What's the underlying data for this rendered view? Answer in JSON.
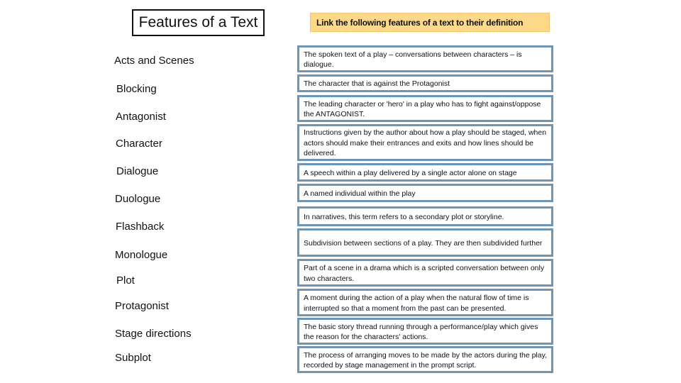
{
  "title": "Features of a Text",
  "instruction": "Link the following features of a text to their definition",
  "colors": {
    "banner_fill": "#ffd98a",
    "box_border": "#6f95b6",
    "title_border": "#111111"
  },
  "terms": [
    "Acts and Scenes",
    "Blocking",
    "Antagonist",
    "Character",
    "Dialogue",
    "Duologue",
    "Flashback",
    "Monologue",
    "Plot",
    "Protagonist",
    "Stage directions",
    "Subplot"
  ],
  "definitions": [
    "The spoken text of a play – conversations between characters – is dialogue.",
    "The character that is against the Protagonist",
    "The leading character or 'hero' in a play who has to fight against/oppose the ANTAGONIST.",
    "Instructions given by the author about how a play should be staged, when actors should make their entrances and exits and how lines should be delivered.",
    "A speech within a play delivered by a single actor alone on stage",
    "A named individual within the play",
    "In narratives, this term refers to a secondary plot or storyline.",
    "Subdivision between sections of a play. They are then subdivided further",
    "Part of a scene in a drama which is a scripted conversation between only two characters.",
    "A moment during the action of a play when the natural flow of time is interrupted so that a moment from the past can be presented.",
    "The basic story thread running through a performance/play which gives the reason for the characters' actions.",
    "The process of arranging moves to be made by the actors during the play, recorded by stage management in the prompt script."
  ]
}
